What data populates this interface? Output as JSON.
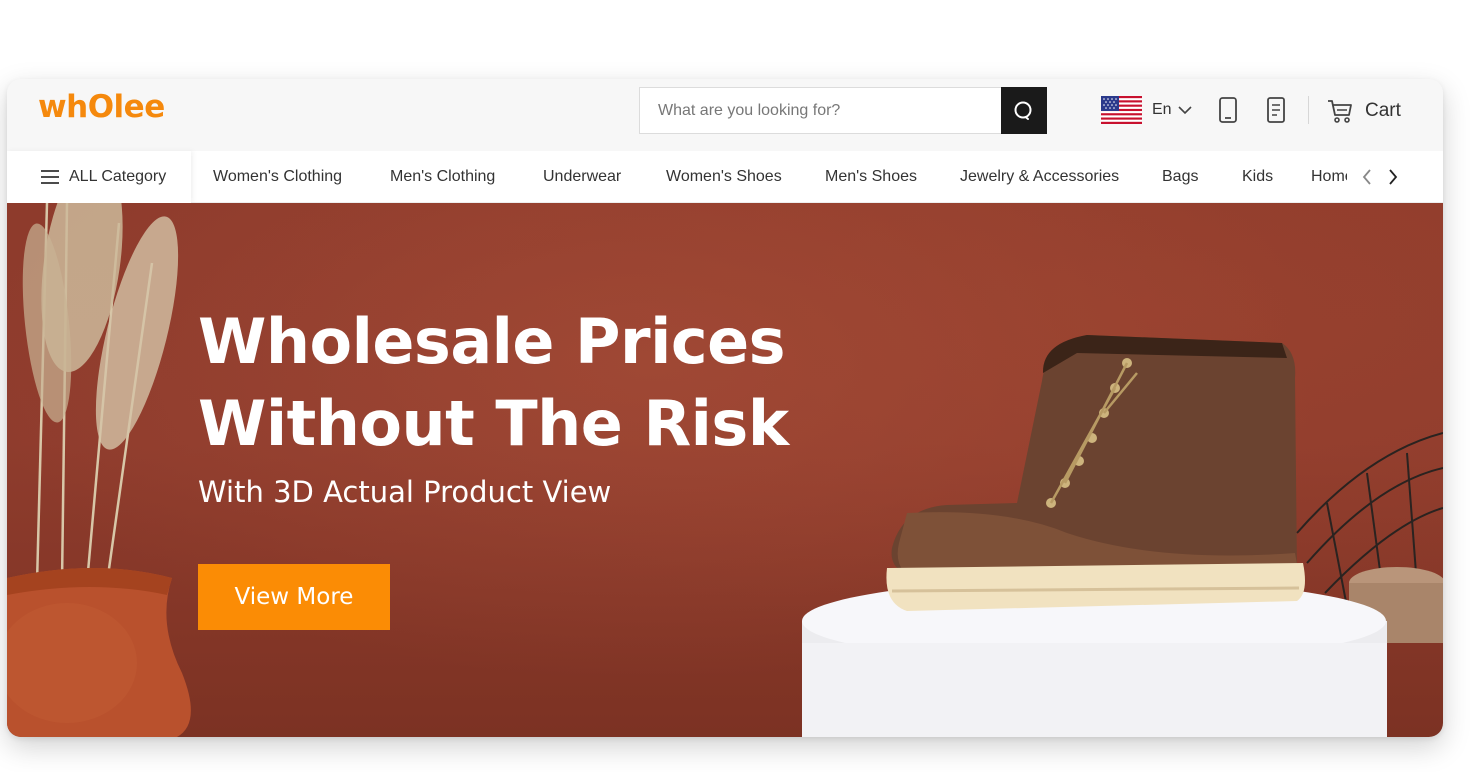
{
  "header": {
    "logo_text": "whOlee",
    "search": {
      "placeholder": "What are you looking for?",
      "value": ""
    },
    "language": {
      "label": "En"
    },
    "cart_label": "Cart"
  },
  "nav": {
    "all_category_label": "ALL Category",
    "items": [
      {
        "label": "Women's Clothing"
      },
      {
        "label": "Men's Clothing"
      },
      {
        "label": "Underwear"
      },
      {
        "label": "Women's Shoes"
      },
      {
        "label": "Men's Shoes"
      },
      {
        "label": "Jewelry & Accessories"
      },
      {
        "label": "Bags"
      },
      {
        "label": "Kids"
      },
      {
        "label": "Home"
      }
    ]
  },
  "hero": {
    "title_line1": "Wholesale Prices",
    "title_line2": "Without The Risk",
    "subtitle": "With 3D Actual Product View",
    "button_label": "View More"
  },
  "colors": {
    "brand_orange": "#f5890d",
    "button_orange": "#fb8c05",
    "hero_background": "#8f3c2d",
    "search_button": "#1a1a1a"
  },
  "icons": [
    "search-icon",
    "us-flag-icon",
    "chevron-down-icon",
    "mobile-phone-icon",
    "order-list-icon",
    "cart-icon",
    "hamburger-menu-icon",
    "chevron-left-icon",
    "chevron-right-icon"
  ]
}
